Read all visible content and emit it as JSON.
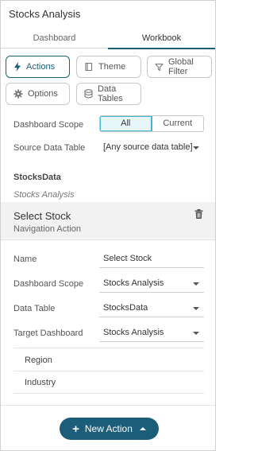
{
  "panel": {
    "title": "Stocks Analysis"
  },
  "tabs": [
    {
      "label": "Dashboard"
    },
    {
      "label": "Workbook"
    }
  ],
  "toolbar": {
    "actions": "Actions",
    "theme": "Theme",
    "global_filter": "Global Filter",
    "options": "Options",
    "data_tables": "Data Tables"
  },
  "filters": {
    "dashboard_scope_label": "Dashboard Scope",
    "scope_all": "All",
    "scope_current": "Current",
    "source_table_label": "Source Data Table",
    "source_table_value": "[Any source data table]"
  },
  "group": {
    "title": "StocksData",
    "subtitle": "Stocks Analysis"
  },
  "action_item": {
    "name": "Select Stock",
    "type": "Navigation Action"
  },
  "form": {
    "name_label": "Name",
    "name_value": "Select Stock",
    "scope_label": "Dashboard Scope",
    "scope_value": "Stocks Analysis",
    "table_label": "Data Table",
    "table_value": "StocksData",
    "target_label": "Target Dashboard",
    "target_value": "Stocks Analysis"
  },
  "parameters": [
    {
      "label": "Region"
    },
    {
      "label": "Industry"
    }
  ],
  "footer": {
    "new_action": "New Action"
  },
  "colors": {
    "accent": "#1c5e7a",
    "segment_active": "#45b5d5"
  },
  "icons": {
    "actions": "lightning-icon",
    "theme": "book-icon",
    "global_filter": "funnel-icon",
    "options": "gear-icon",
    "data_tables": "database-icon",
    "delete": "trash-icon"
  }
}
